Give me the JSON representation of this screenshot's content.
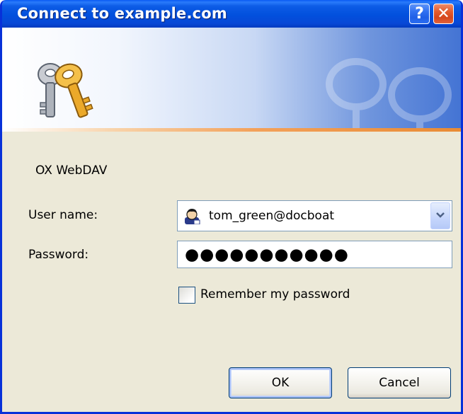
{
  "window": {
    "title": "Connect to example.com",
    "help_glyph": "?",
    "close_glyph": "✕"
  },
  "dialog": {
    "realm": "OX WebDAV",
    "username_label": "User name:",
    "username_value": "tom_green@docboat",
    "password_label": "Password:",
    "password_masked": "●●●●●●●●●●●",
    "remember_label": "Remember my password",
    "remember_checked": false
  },
  "buttons": {
    "ok": "OK",
    "cancel": "Cancel"
  },
  "icons": {
    "banner": "keys-icon",
    "user": "user-account-icon",
    "dropdown": "chevron-down-icon"
  },
  "colors": {
    "titlebar": "#0250dd",
    "dialog_bg": "#ece9d8",
    "close_button": "#d5471d",
    "field_border": "#7f9db9"
  }
}
